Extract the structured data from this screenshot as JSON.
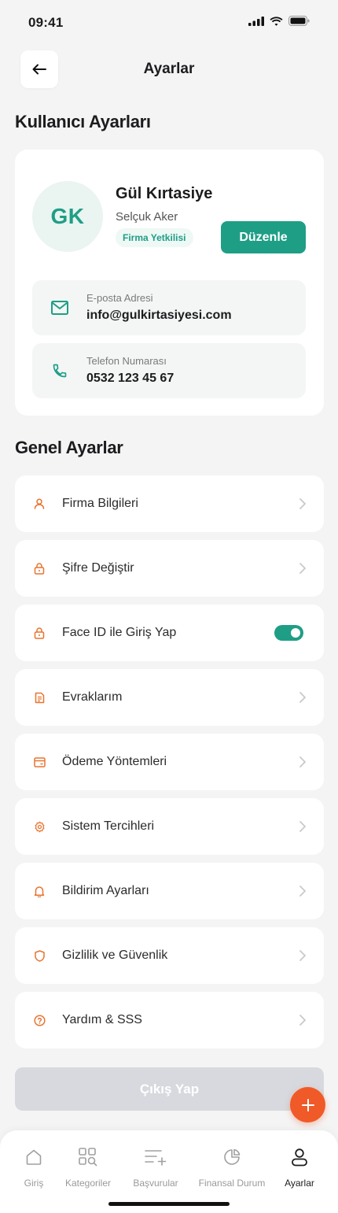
{
  "status_bar": {
    "time": "09:41"
  },
  "header": {
    "title": "Ayarlar"
  },
  "user_section": {
    "title": "Kullanıcı Ayarları",
    "avatar_initials": "GK",
    "company_name": "Gül Kırtasiye",
    "person_name": "Selçuk Aker",
    "role": "Firma Yetkilisi",
    "edit_label": "Düzenle",
    "email": {
      "label": "E-posta Adresi",
      "value": "info@gulkirtasiyesi.com"
    },
    "phone": {
      "label": "Telefon Numarası",
      "value": "0532 123 45 67"
    }
  },
  "general_section": {
    "title": "Genel Ayarlar",
    "items": [
      {
        "label": "Firma Bilgileri",
        "icon": "user-icon",
        "control": "chevron"
      },
      {
        "label": "Şifre Değiştir",
        "icon": "lock-icon",
        "control": "chevron"
      },
      {
        "label": "Face ID ile Giriş Yap",
        "icon": "lock-icon",
        "control": "toggle",
        "enabled": true
      },
      {
        "label": "Evraklarım",
        "icon": "document-icon",
        "control": "chevron"
      },
      {
        "label": "Ödeme Yöntemleri",
        "icon": "card-icon",
        "control": "chevron"
      },
      {
        "label": "Sistem Tercihleri",
        "icon": "gear-icon",
        "control": "chevron"
      },
      {
        "label": "Bildirim Ayarları",
        "icon": "bell-icon",
        "control": "chevron"
      },
      {
        "label": "Gizlilik ve Güvenlik",
        "icon": "shield-icon",
        "control": "chevron"
      },
      {
        "label": "Yardım & SSS",
        "icon": "help-icon",
        "control": "chevron"
      }
    ]
  },
  "logout_label": "Çıkış Yap",
  "bottom_nav": {
    "items": [
      {
        "label": "Giriş",
        "icon": "home-icon"
      },
      {
        "label": "Kategoriler",
        "icon": "category-search-icon"
      },
      {
        "label": "Başvurular",
        "icon": "list-add-icon"
      },
      {
        "label": "Finansal Durum",
        "icon": "pie-chart-icon"
      },
      {
        "label": "Ayarlar",
        "icon": "profile-icon",
        "active": true
      }
    ]
  },
  "colors": {
    "primary": "#1f9e86",
    "accent": "#f05a28",
    "icon_orange": "#e8742f",
    "background": "#f4f4f5"
  }
}
